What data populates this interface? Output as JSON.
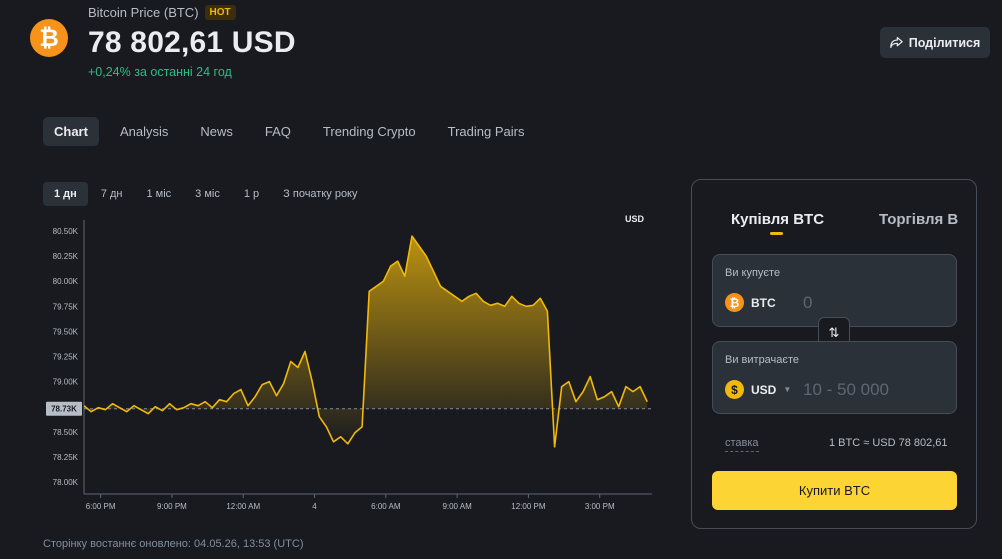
{
  "header": {
    "coin_symbol_glyph": "₿",
    "pair_title": "Bitcoin Price (BTC)",
    "hot_badge": "HOT",
    "price": "78 802,61 USD",
    "change": "+0,24% за останні 24 год",
    "share_label": "Поділитися"
  },
  "tabs": [
    {
      "label": "Chart",
      "active": true
    },
    {
      "label": "Analysis",
      "active": false
    },
    {
      "label": "News",
      "active": false
    },
    {
      "label": "FAQ",
      "active": false
    },
    {
      "label": "Trending Crypto",
      "active": false
    },
    {
      "label": "Trading Pairs",
      "active": false
    }
  ],
  "ranges": [
    {
      "label": "1 дн",
      "active": true
    },
    {
      "label": "7 дн",
      "active": false
    },
    {
      "label": "1 міс",
      "active": false
    },
    {
      "label": "3 міс",
      "active": false
    },
    {
      "label": "1 р",
      "active": false
    },
    {
      "label": "З початку року",
      "active": false
    }
  ],
  "chart_data": {
    "type": "area",
    "currency_label": "USD",
    "y_ticks": [
      "78.00K",
      "78.25K",
      "78.50K",
      "78.75K",
      "79.00K",
      "79.25K",
      "79.50K",
      "79.75K",
      "80.00K",
      "80.25K",
      "80.50K"
    ],
    "y_tick_values": [
      78000,
      78250,
      78500,
      78750,
      79000,
      79250,
      79500,
      79750,
      80000,
      80250,
      80500
    ],
    "ylim": [
      77900,
      80650
    ],
    "x_ticks": [
      "6:00 PM",
      "9:00 PM",
      "12:00 AM",
      "4",
      "6:00 AM",
      "9:00 AM",
      "12:00 PM",
      "3:00 PM"
    ],
    "x_tick_values": [
      1,
      4,
      7,
      10,
      13,
      16,
      19,
      22
    ],
    "xlim": [
      0.3,
      24.2
    ],
    "reference_value": 78730,
    "reference_label": "78.73K",
    "colors": {
      "line": "#f0b90b",
      "fill_top": "#f0b90b",
      "reference": "#848e9c"
    },
    "series": [
      {
        "x": [
          0.3,
          0.6,
          0.9,
          1.2,
          1.5,
          1.8,
          2.1,
          2.4,
          2.7,
          3.0,
          3.3,
          3.6,
          3.9,
          4.2,
          4.5,
          4.8,
          5.1,
          5.4,
          5.7,
          6.0,
          6.3,
          6.6,
          6.9,
          7.2,
          7.5,
          7.8,
          8.1,
          8.4,
          8.7,
          9.0,
          9.3,
          9.6,
          9.9,
          10.2,
          10.5,
          10.8,
          11.1,
          11.4,
          11.7,
          12.0,
          12.3,
          12.6,
          12.9,
          13.2,
          13.5,
          13.8,
          14.1,
          14.4,
          14.7,
          15.0,
          15.3,
          15.6,
          15.9,
          16.2,
          16.5,
          16.8,
          17.1,
          17.4,
          17.7,
          18.0,
          18.3,
          18.6,
          18.9,
          19.2,
          19.5,
          19.8,
          20.1,
          20.4,
          20.7,
          21.0,
          21.3,
          21.6,
          21.9,
          22.2,
          22.5,
          22.8,
          23.1,
          23.4,
          23.7,
          24.0
        ],
        "y": [
          78760,
          78700,
          78740,
          78720,
          78780,
          78740,
          78700,
          78760,
          78720,
          78680,
          78750,
          78710,
          78780,
          78720,
          78740,
          78780,
          78760,
          78800,
          78740,
          78820,
          78800,
          78880,
          78920,
          78760,
          78850,
          78970,
          79000,
          78860,
          78980,
          79200,
          79140,
          79300,
          79000,
          78650,
          78550,
          78400,
          78450,
          78380,
          78490,
          78550,
          79900,
          79950,
          80000,
          80150,
          80200,
          80050,
          80450,
          80350,
          80250,
          80100,
          79950,
          79900,
          79850,
          79800,
          79850,
          79880,
          79800,
          79760,
          79780,
          79750,
          79850,
          79780,
          79750,
          79760,
          79830,
          79700,
          78350,
          78950,
          79000,
          78800,
          78900,
          79050,
          78820,
          78850,
          78900,
          78750,
          78950,
          78900,
          78950,
          78800
        ]
      }
    ]
  },
  "updated_text": "Сторінку востаннє оновлено: 04.05.26, 13:53 (UTC)",
  "trade": {
    "tab_buy": "Купівля BTC",
    "tab_trade": "Торгівля В",
    "buy_box": {
      "label": "Ви купуєте",
      "currency": "BTC",
      "placeholder": "0"
    },
    "spend_box": {
      "label": "Ви витрачаєте",
      "currency": "USD",
      "placeholder": "10 - 50 000"
    },
    "rate_label": "ставка",
    "rate_value": "1 BTC ≈ USD 78 802,61",
    "buy_button": "Купити BTC",
    "btc_glyph": "₿",
    "usd_glyph": "$",
    "swap_glyph": "⇅"
  }
}
